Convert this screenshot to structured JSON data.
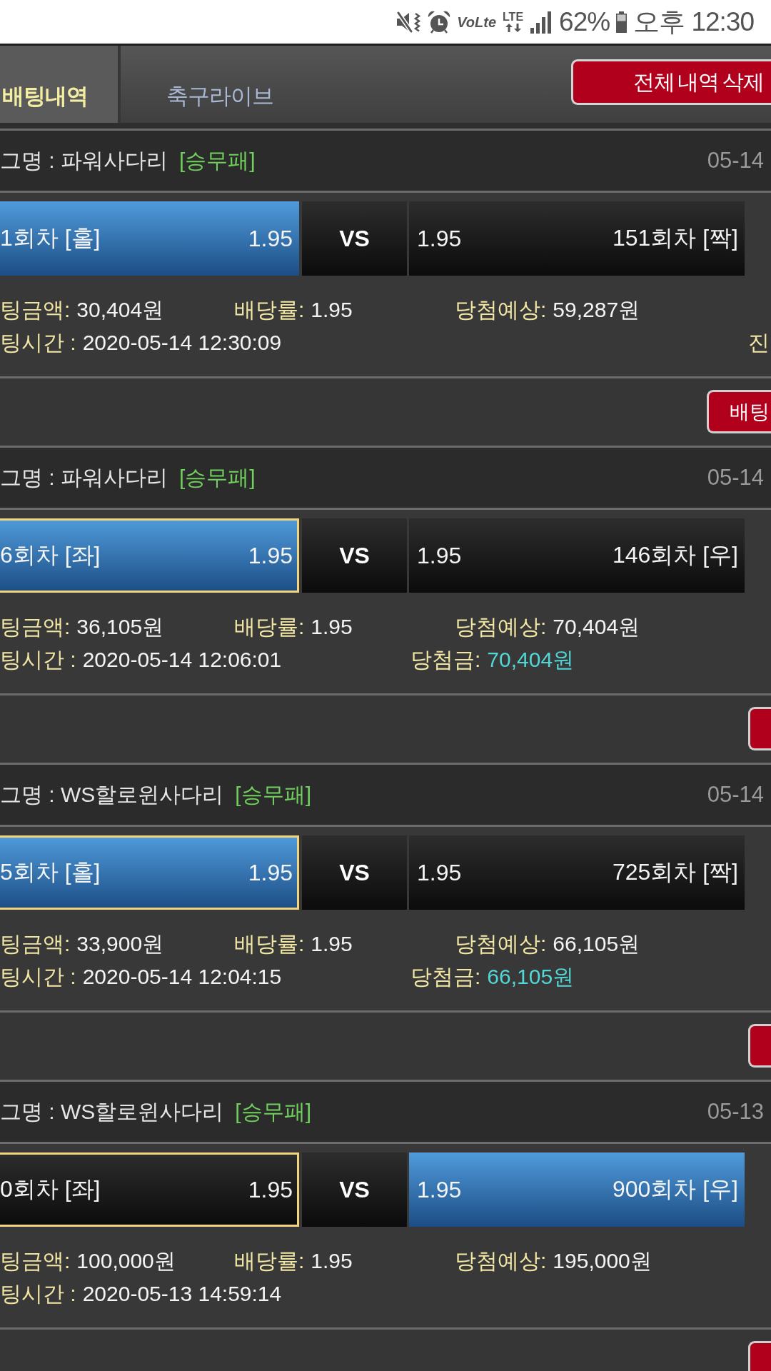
{
  "status_bar": {
    "volte_label": "VoLte",
    "network_label": "LTE",
    "battery": "62%",
    "time": "오후 12:30"
  },
  "tabs": [
    {
      "label": "배팅내역",
      "selected": true
    },
    {
      "label": "축구라이브",
      "selected": false
    }
  ],
  "delete_all_button": {
    "label": "전체 내역 삭제"
  },
  "bets": [
    {
      "league": "그명 : 파워사다리",
      "tag": "[승무패]",
      "date": "05-14",
      "home": {
        "team": "1회차 [홀]",
        "odds": "1.95",
        "highlighted": true,
        "framed": false
      },
      "vs": "VS",
      "away": {
        "odds": "1.95",
        "team": "151회차 [짝]",
        "highlighted": false,
        "framed": false
      },
      "stake": {
        "label": "팅금액:",
        "value": "30,404원"
      },
      "rate": {
        "label": "배당률:",
        "value": "1.95"
      },
      "expected": {
        "label": "당첨예상:",
        "value": "59,287원"
      },
      "bet_time": {
        "label": "팅시간 :",
        "value": "2020-05-14 12:30:09"
      },
      "status": "진",
      "action_button": {
        "kind": "labeled",
        "label": "배팅"
      }
    },
    {
      "league": "그명 : 파워사다리",
      "tag": "[승무패]",
      "date": "05-14",
      "home": {
        "team": "6회차 [좌]",
        "odds": "1.95",
        "highlighted": true,
        "framed": true
      },
      "vs": "VS",
      "away": {
        "odds": "1.95",
        "team": "146회차 [우]",
        "highlighted": false,
        "framed": false
      },
      "stake": {
        "label": "팅금액:",
        "value": "36,105원"
      },
      "rate": {
        "label": "배당률:",
        "value": "1.95"
      },
      "expected": {
        "label": "당첨예상:",
        "value": "70,404원"
      },
      "bet_time": {
        "label": "팅시간 :",
        "value": "2020-05-14 12:06:01"
      },
      "winnings": {
        "label": "당첨금:",
        "value": "70,404원"
      },
      "action_button": {
        "kind": "stub"
      }
    },
    {
      "league": "그명 : WS할로윈사다리",
      "tag": "[승무패]",
      "date": "05-14",
      "home": {
        "team": "5회차 [홀]",
        "odds": "1.95",
        "highlighted": true,
        "framed": true
      },
      "vs": "VS",
      "away": {
        "odds": "1.95",
        "team": "725회차 [짝]",
        "highlighted": false,
        "framed": false
      },
      "stake": {
        "label": "팅금액:",
        "value": "33,900원"
      },
      "rate": {
        "label": "배당률:",
        "value": "1.95"
      },
      "expected": {
        "label": "당첨예상:",
        "value": "66,105원"
      },
      "bet_time": {
        "label": "팅시간 :",
        "value": "2020-05-14 12:04:15"
      },
      "winnings": {
        "label": "당첨금:",
        "value": "66,105원"
      },
      "action_button": {
        "kind": "stub"
      }
    },
    {
      "league": "그명 : WS할로윈사다리",
      "tag": "[승무패]",
      "date": "05-13",
      "home": {
        "team": "0회차 [좌]",
        "odds": "1.95",
        "highlighted": false,
        "framed": true
      },
      "vs": "VS",
      "away": {
        "odds": "1.95",
        "team": "900회차 [우]",
        "highlighted": true,
        "framed": false
      },
      "stake": {
        "label": "팅금액:",
        "value": "100,000원"
      },
      "rate": {
        "label": "배당률:",
        "value": "1.95"
      },
      "expected": {
        "label": "당첨예상:",
        "value": "195,000원"
      },
      "bet_time": {
        "label": "팅시간 :",
        "value": "2020-05-13 14:59:14"
      },
      "action_button": {
        "kind": "stub"
      }
    }
  ]
}
